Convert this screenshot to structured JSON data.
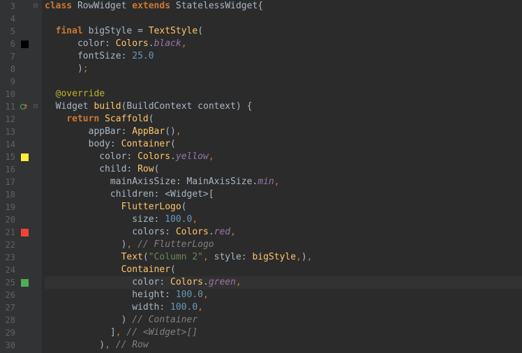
{
  "gutter": {
    "lines": [
      {
        "num": "3",
        "swatch": null,
        "icon": null,
        "fold": "⊟"
      },
      {
        "num": "4",
        "swatch": null,
        "icon": null,
        "fold": ""
      },
      {
        "num": "5",
        "swatch": null,
        "icon": null,
        "fold": ""
      },
      {
        "num": "6",
        "swatch": "#000000",
        "icon": null,
        "fold": ""
      },
      {
        "num": "7",
        "swatch": null,
        "icon": null,
        "fold": ""
      },
      {
        "num": "8",
        "swatch": null,
        "icon": null,
        "fold": ""
      },
      {
        "num": "9",
        "swatch": null,
        "icon": null,
        "fold": ""
      },
      {
        "num": "10",
        "swatch": null,
        "icon": null,
        "fold": ""
      },
      {
        "num": "11",
        "swatch": null,
        "icon": "override",
        "fold": "⊟"
      },
      {
        "num": "12",
        "swatch": null,
        "icon": null,
        "fold": ""
      },
      {
        "num": "13",
        "swatch": null,
        "icon": null,
        "fold": ""
      },
      {
        "num": "14",
        "swatch": null,
        "icon": null,
        "fold": ""
      },
      {
        "num": "15",
        "swatch": "#ffeb3b",
        "icon": null,
        "fold": ""
      },
      {
        "num": "16",
        "swatch": null,
        "icon": null,
        "fold": ""
      },
      {
        "num": "17",
        "swatch": null,
        "icon": null,
        "fold": ""
      },
      {
        "num": "18",
        "swatch": null,
        "icon": null,
        "fold": ""
      },
      {
        "num": "19",
        "swatch": null,
        "icon": null,
        "fold": ""
      },
      {
        "num": "20",
        "swatch": null,
        "icon": null,
        "fold": ""
      },
      {
        "num": "21",
        "swatch": "#f44336",
        "icon": null,
        "fold": ""
      },
      {
        "num": "22",
        "swatch": null,
        "icon": null,
        "fold": ""
      },
      {
        "num": "23",
        "swatch": null,
        "icon": null,
        "fold": ""
      },
      {
        "num": "24",
        "swatch": null,
        "icon": null,
        "fold": ""
      },
      {
        "num": "25",
        "swatch": "#4caf50",
        "icon": null,
        "fold": ""
      },
      {
        "num": "26",
        "swatch": null,
        "icon": null,
        "fold": ""
      },
      {
        "num": "27",
        "swatch": null,
        "icon": null,
        "fold": ""
      },
      {
        "num": "28",
        "swatch": null,
        "icon": null,
        "fold": ""
      },
      {
        "num": "29",
        "swatch": null,
        "icon": null,
        "fold": ""
      },
      {
        "num": "30",
        "swatch": null,
        "icon": null,
        "fold": ""
      }
    ]
  },
  "code": {
    "t": {
      "class": "class",
      "extends": "extends",
      "final": "final",
      "return": "return",
      "RowWidget": "RowWidget",
      "StatelessWidget": "StatelessWidget",
      "bigStyle": "bigStyle",
      "TextStyle": "TextStyle",
      "color": "color",
      "Colors": "Colors",
      "black": "black",
      "fontSize": "fontSize",
      "v25": "25.0",
      "override": "@override",
      "Widget": "Widget",
      "build": "build",
      "BuildContext": "BuildContext",
      "context": "context",
      "Scaffold": "Scaffold",
      "appBar": "appBar",
      "AppBar": "AppBar",
      "body": "body",
      "Container": "Container",
      "yellow": "yellow",
      "child": "child",
      "Row": "Row",
      "mainAxisSize": "mainAxisSize",
      "MainAxisSize": "MainAxisSize",
      "min": "min",
      "children": "children",
      "FlutterLogo": "FlutterLogo",
      "size": "size",
      "v100": "100.0",
      "colors": "colors",
      "red": "red",
      "cmtFlutterLogo": "// FlutterLogo",
      "Text": "Text",
      "strCol2": "\"Column 2\"",
      "style": "style",
      "green": "green",
      "height": "height",
      "width": "width",
      "cmtContainer": "// Container",
      "cmtWidget": "// <Widget>[]",
      "cmtRow": "// Row"
    }
  }
}
